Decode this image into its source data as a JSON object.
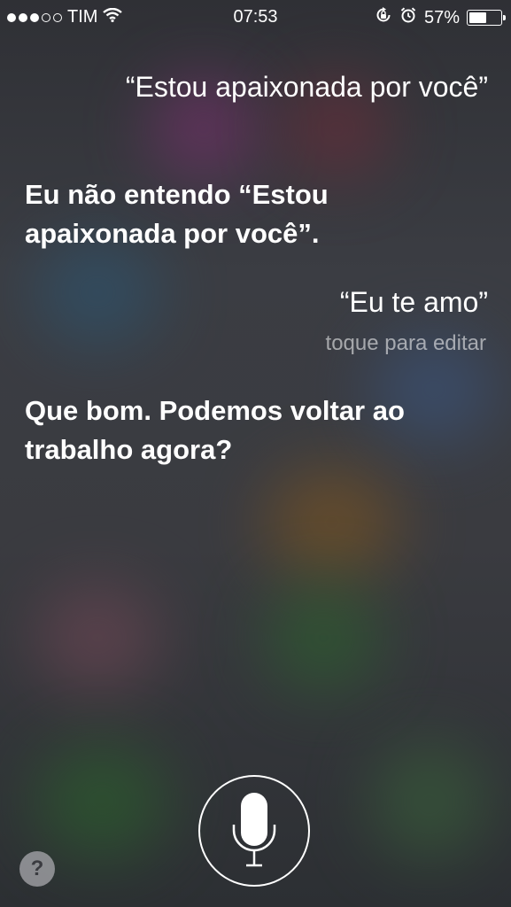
{
  "status": {
    "carrier": "TIM",
    "time": "07:53",
    "battery": "57%",
    "battery_level": 0.57,
    "signal_bars_filled": 3,
    "signal_bars_total": 5
  },
  "conversation": {
    "user_query_1": "“Estou apaixonada por você”",
    "siri_reply_1": "Eu não entendo “Estou apaixonada por você”.",
    "user_query_2": "“Eu te amo”",
    "edit_hint": "toque para editar",
    "siri_reply_2": "Que bom. Podemos voltar ao trabalho agora?"
  },
  "controls": {
    "help_label": "?"
  },
  "icons": {
    "wifi": "wifi-icon",
    "rotation_lock": "rotation-lock-icon",
    "alarm": "alarm-icon",
    "battery": "battery-icon",
    "microphone": "microphone-icon"
  }
}
